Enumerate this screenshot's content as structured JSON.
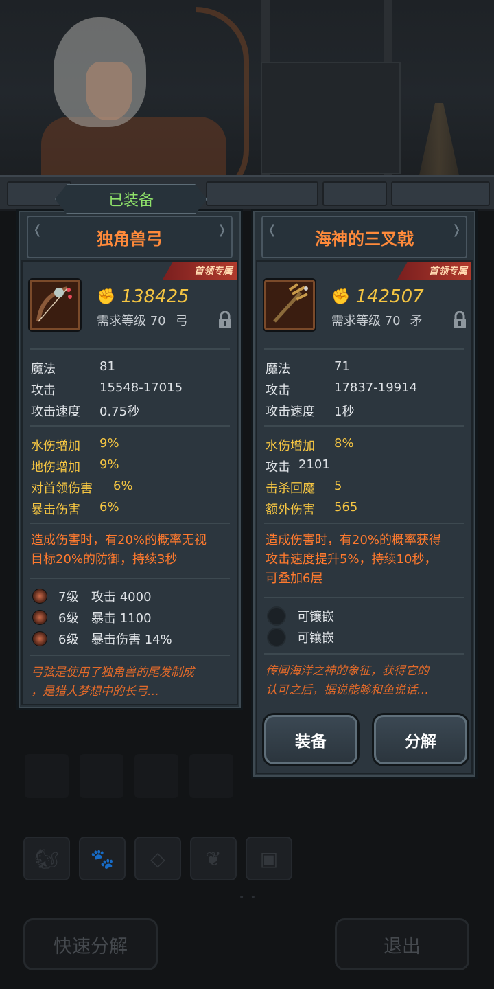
{
  "equipped_label": "已装备",
  "left_item": {
    "name": "独角兽弓",
    "tag": "首领专属",
    "power": "138425",
    "requirement": "需求等级 70",
    "weapon_type": "弓",
    "base_stats": [
      {
        "label": "魔法",
        "value": "81"
      },
      {
        "label": "攻击",
        "value": "15548-17015"
      },
      {
        "label": "攻击速度",
        "value": "0.75秒"
      }
    ],
    "bonus_stats": [
      {
        "label": "水伤增加",
        "value": "9%"
      },
      {
        "label": "地伤增加",
        "value": "9%"
      },
      {
        "label": "对首领伤害",
        "value": "6%"
      },
      {
        "label": "暴击伤害",
        "value": "6%"
      }
    ],
    "effect_lines": [
      "造成伤害时，有20%的概率无视",
      "目标20%的防御，持续3秒"
    ],
    "gems": [
      {
        "level": "7级",
        "stat": "攻击 4000"
      },
      {
        "level": "6级",
        "stat": "暴击 1100"
      },
      {
        "level": "6级",
        "stat": "暴击伤害 14%"
      }
    ],
    "lore_lines": [
      "弓弦是使用了独角兽的尾发制成",
      "，是猎人梦想中的长弓…"
    ]
  },
  "right_item": {
    "name": "海神的三叉戟",
    "tag": "首领专属",
    "power": "142507",
    "requirement": "需求等级 70",
    "weapon_type": "矛",
    "base_stats": [
      {
        "label": "魔法",
        "value": "71"
      },
      {
        "label": "攻击",
        "value": "17837-19914"
      },
      {
        "label": "攻击速度",
        "value": "1秒"
      }
    ],
    "bonus_stats": [
      {
        "label": "水伤增加",
        "value": "8%"
      },
      {
        "label": "攻击",
        "value": "2101"
      },
      {
        "label": "击杀回魔",
        "value": "5"
      },
      {
        "label": "额外伤害",
        "value": "565"
      }
    ],
    "effect_lines": [
      "造成伤害时，有20%的概率获得",
      "攻击速度提升5%，持续10秒，",
      "可叠加6层"
    ],
    "sockets": [
      "可镶嵌",
      "可镶嵌"
    ],
    "lore_lines": [
      "传闻海洋之神的象征，获得它的",
      "认可之后，据说能够和鱼说话…"
    ],
    "equip_button": "装备",
    "decompose_button": "分解"
  },
  "bottom": {
    "quick_decompose": "快速分解",
    "exit": "退出"
  },
  "category_icons": [
    "squirrel-icon",
    "paw-icon",
    "gem-icon",
    "leaf-icon",
    "chest-icon"
  ],
  "colors": {
    "title_orange": "#ff8a3a",
    "power_gold": "#f5c542",
    "equipped_green": "#8fe26a",
    "effect_orange": "#ff7a2e",
    "panel_bg": "#283239"
  }
}
